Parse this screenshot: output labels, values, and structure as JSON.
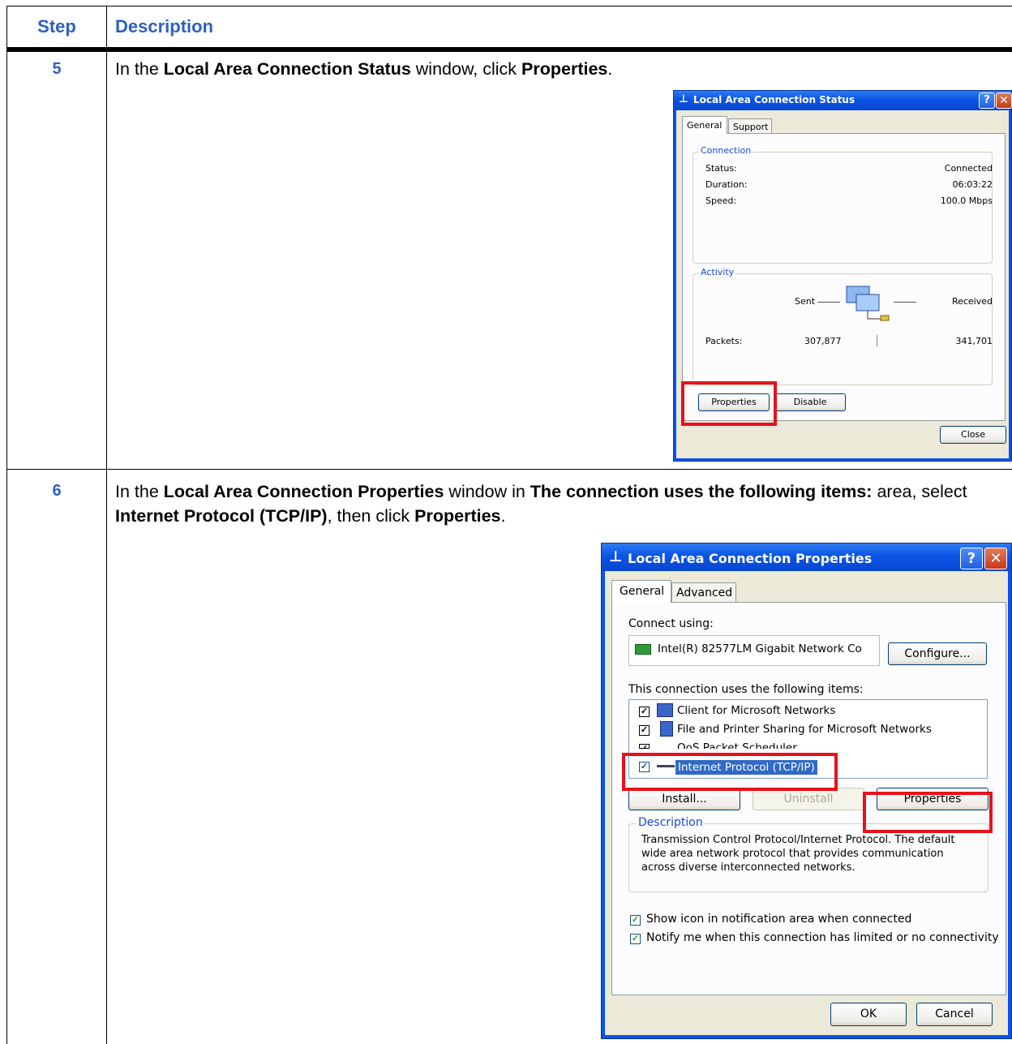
{
  "table": {
    "header": {
      "step": "Step",
      "description": "Description"
    },
    "rows": [
      {
        "step": "5",
        "text": [
          {
            "t": "In the ",
            "b": false
          },
          {
            "t": "Local Area Connection Status",
            "b": true
          },
          {
            "t": " window, click ",
            "b": false
          },
          {
            "t": "Properties",
            "b": true
          },
          {
            "t": ".",
            "b": false
          }
        ]
      },
      {
        "step": "6",
        "text": [
          {
            "t": "In the ",
            "b": false
          },
          {
            "t": "Local Area Connection Properties",
            "b": true
          },
          {
            "t": " window in ",
            "b": false
          },
          {
            "t": "The connection uses the following items:",
            "b": true
          },
          {
            "t": " area, select ",
            "b": false
          },
          {
            "t": "Internet Protocol (TCP/IP)",
            "b": true
          },
          {
            "t": ", then click ",
            "b": false
          },
          {
            "t": "Properties",
            "b": true
          },
          {
            "t": ".",
            "b": false
          }
        ]
      }
    ]
  },
  "status_window": {
    "title": "Local Area Connection Status",
    "tabs": [
      "General",
      "Support"
    ],
    "connection_group": "Connection",
    "status_label": "Status:",
    "status_value": "Connected",
    "duration_label": "Duration:",
    "duration_value": "06:03:22",
    "speed_label": "Speed:",
    "speed_value": "100.0 Mbps",
    "activity_group": "Activity",
    "sent_label": "Sent",
    "received_label": "Received",
    "packets_label": "Packets:",
    "packets_sent": "307,877",
    "packets_received": "341,701",
    "properties_button": "Properties",
    "disable_button": "Disable",
    "close_button": "Close"
  },
  "properties_window": {
    "title": "Local Area Connection Properties",
    "tabs": [
      "General",
      "Advanced"
    ],
    "connect_using_label": "Connect using:",
    "adapter": "Intel(R) 82577LM Gigabit Network Co",
    "configure_button": "Configure...",
    "items_label": "This connection uses the following items:",
    "items": [
      "Client for Microsoft Networks",
      "File and Printer Sharing for Microsoft Networks",
      "QoS Packet Scheduler",
      "Internet Protocol (TCP/IP)"
    ],
    "install_button": "Install...",
    "uninstall_button": "Uninstall",
    "properties_button": "Properties",
    "description_group": "Description",
    "description_text": "Transmission Control Protocol/Internet Protocol. The default wide area network protocol that provides communication across diverse interconnected networks.",
    "show_icon_label": "Show icon in notification area when connected",
    "notify_label": "Notify me when this connection has limited or no connectivity",
    "ok_button": "OK",
    "cancel_button": "Cancel"
  },
  "colors": {
    "header_blue": "#2f5fbf",
    "highlight_red": "#e8111a",
    "xp_blue": "#0a54e4"
  }
}
